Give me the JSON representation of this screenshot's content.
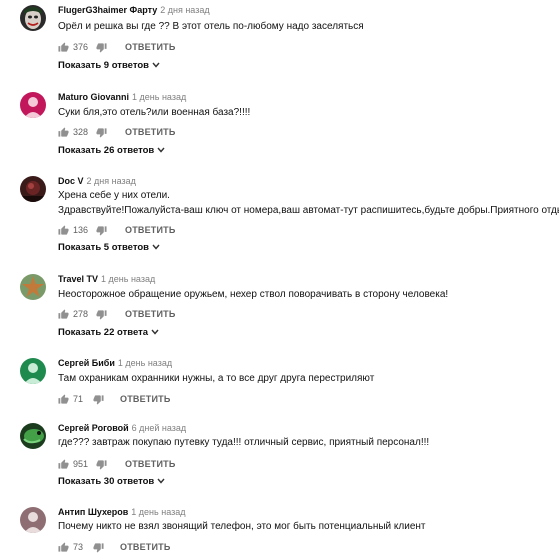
{
  "comments": [
    {
      "author": "FlugerG3haimer Фарту",
      "time": "2 дня назад",
      "lines": [
        "Орёл и решка вы где ?? В этот отель по-любому надо заселяться"
      ],
      "likes": "376",
      "reply_label": "ОТВЕТИТЬ",
      "replies_label": "Показать 9 ответов",
      "avatar_color": "#2a2a2a",
      "avatar_icon": "joker-face-avatar"
    },
    {
      "author": "Maturo Giovanni",
      "time": "1 день назад",
      "lines": [
        "Суки бля,это отель?или военная база?!!!!"
      ],
      "likes": "328",
      "reply_label": "ОТВЕТИТЬ",
      "replies_label": "Показать 26 ответов",
      "avatar_color": "#c2185b",
      "avatar_icon": "default-person-avatar"
    },
    {
      "author": "Doc V",
      "time": "2 дня назад",
      "lines": [
        "Хрена себе у них отели.",
        "Здравствуйте!Пожалуйста-ваш ключ от номера,ваш автомат-тут распишитесь,будьте добры.Приятного отдыха!"
      ],
      "likes": "136",
      "reply_label": "ОТВЕТИТЬ",
      "replies_label": "Показать 5 ответов",
      "avatar_color": "#3b1a1a",
      "avatar_icon": "dark-photo-avatar"
    },
    {
      "author": "Travel TV",
      "time": "1 день назад",
      "lines": [
        "Неосторожное обращение оружьем, нехер ствол поворачивать в сторону человека!"
      ],
      "likes": "278",
      "reply_label": "ОТВЕТИТЬ",
      "replies_label": "Показать 22 ответа",
      "avatar_color": "#7a9a6a",
      "avatar_icon": "starfish-avatar"
    },
    {
      "author": "Сергей Биби",
      "time": "1 день назад",
      "lines": [
        "Там охраникам охранники нужны, а то все друг друга перестриляют"
      ],
      "likes": "71",
      "reply_label": "ОТВЕТИТЬ",
      "replies_label": "",
      "avatar_color": "#1e8a4e",
      "avatar_icon": "default-person-avatar"
    },
    {
      "author": "Сергей Роговой",
      "time": "6 дней назад",
      "lines": [
        "где??? завтраж покупаю путевку туда!!! отличный сервис, приятный персонал!!!"
      ],
      "likes": "951",
      "reply_label": "ОТВЕТИТЬ",
      "replies_label": "Показать 30 ответов",
      "avatar_color": "#2e7d32",
      "avatar_icon": "green-lizard-avatar"
    },
    {
      "author": "Антип Шухеров",
      "time": "1 день назад",
      "lines": [
        "Почему никто не взял звонящий телефон, это мог быть потенциальный клиент"
      ],
      "likes": "73",
      "reply_label": "ОТВЕТИТЬ",
      "replies_label": "",
      "avatar_color": "#8e6e72",
      "avatar_icon": "default-person-avatar"
    }
  ],
  "icons": {
    "like": "thumbs-up-icon",
    "dislike": "thumbs-down-icon",
    "expand": "chevron-down-icon"
  }
}
